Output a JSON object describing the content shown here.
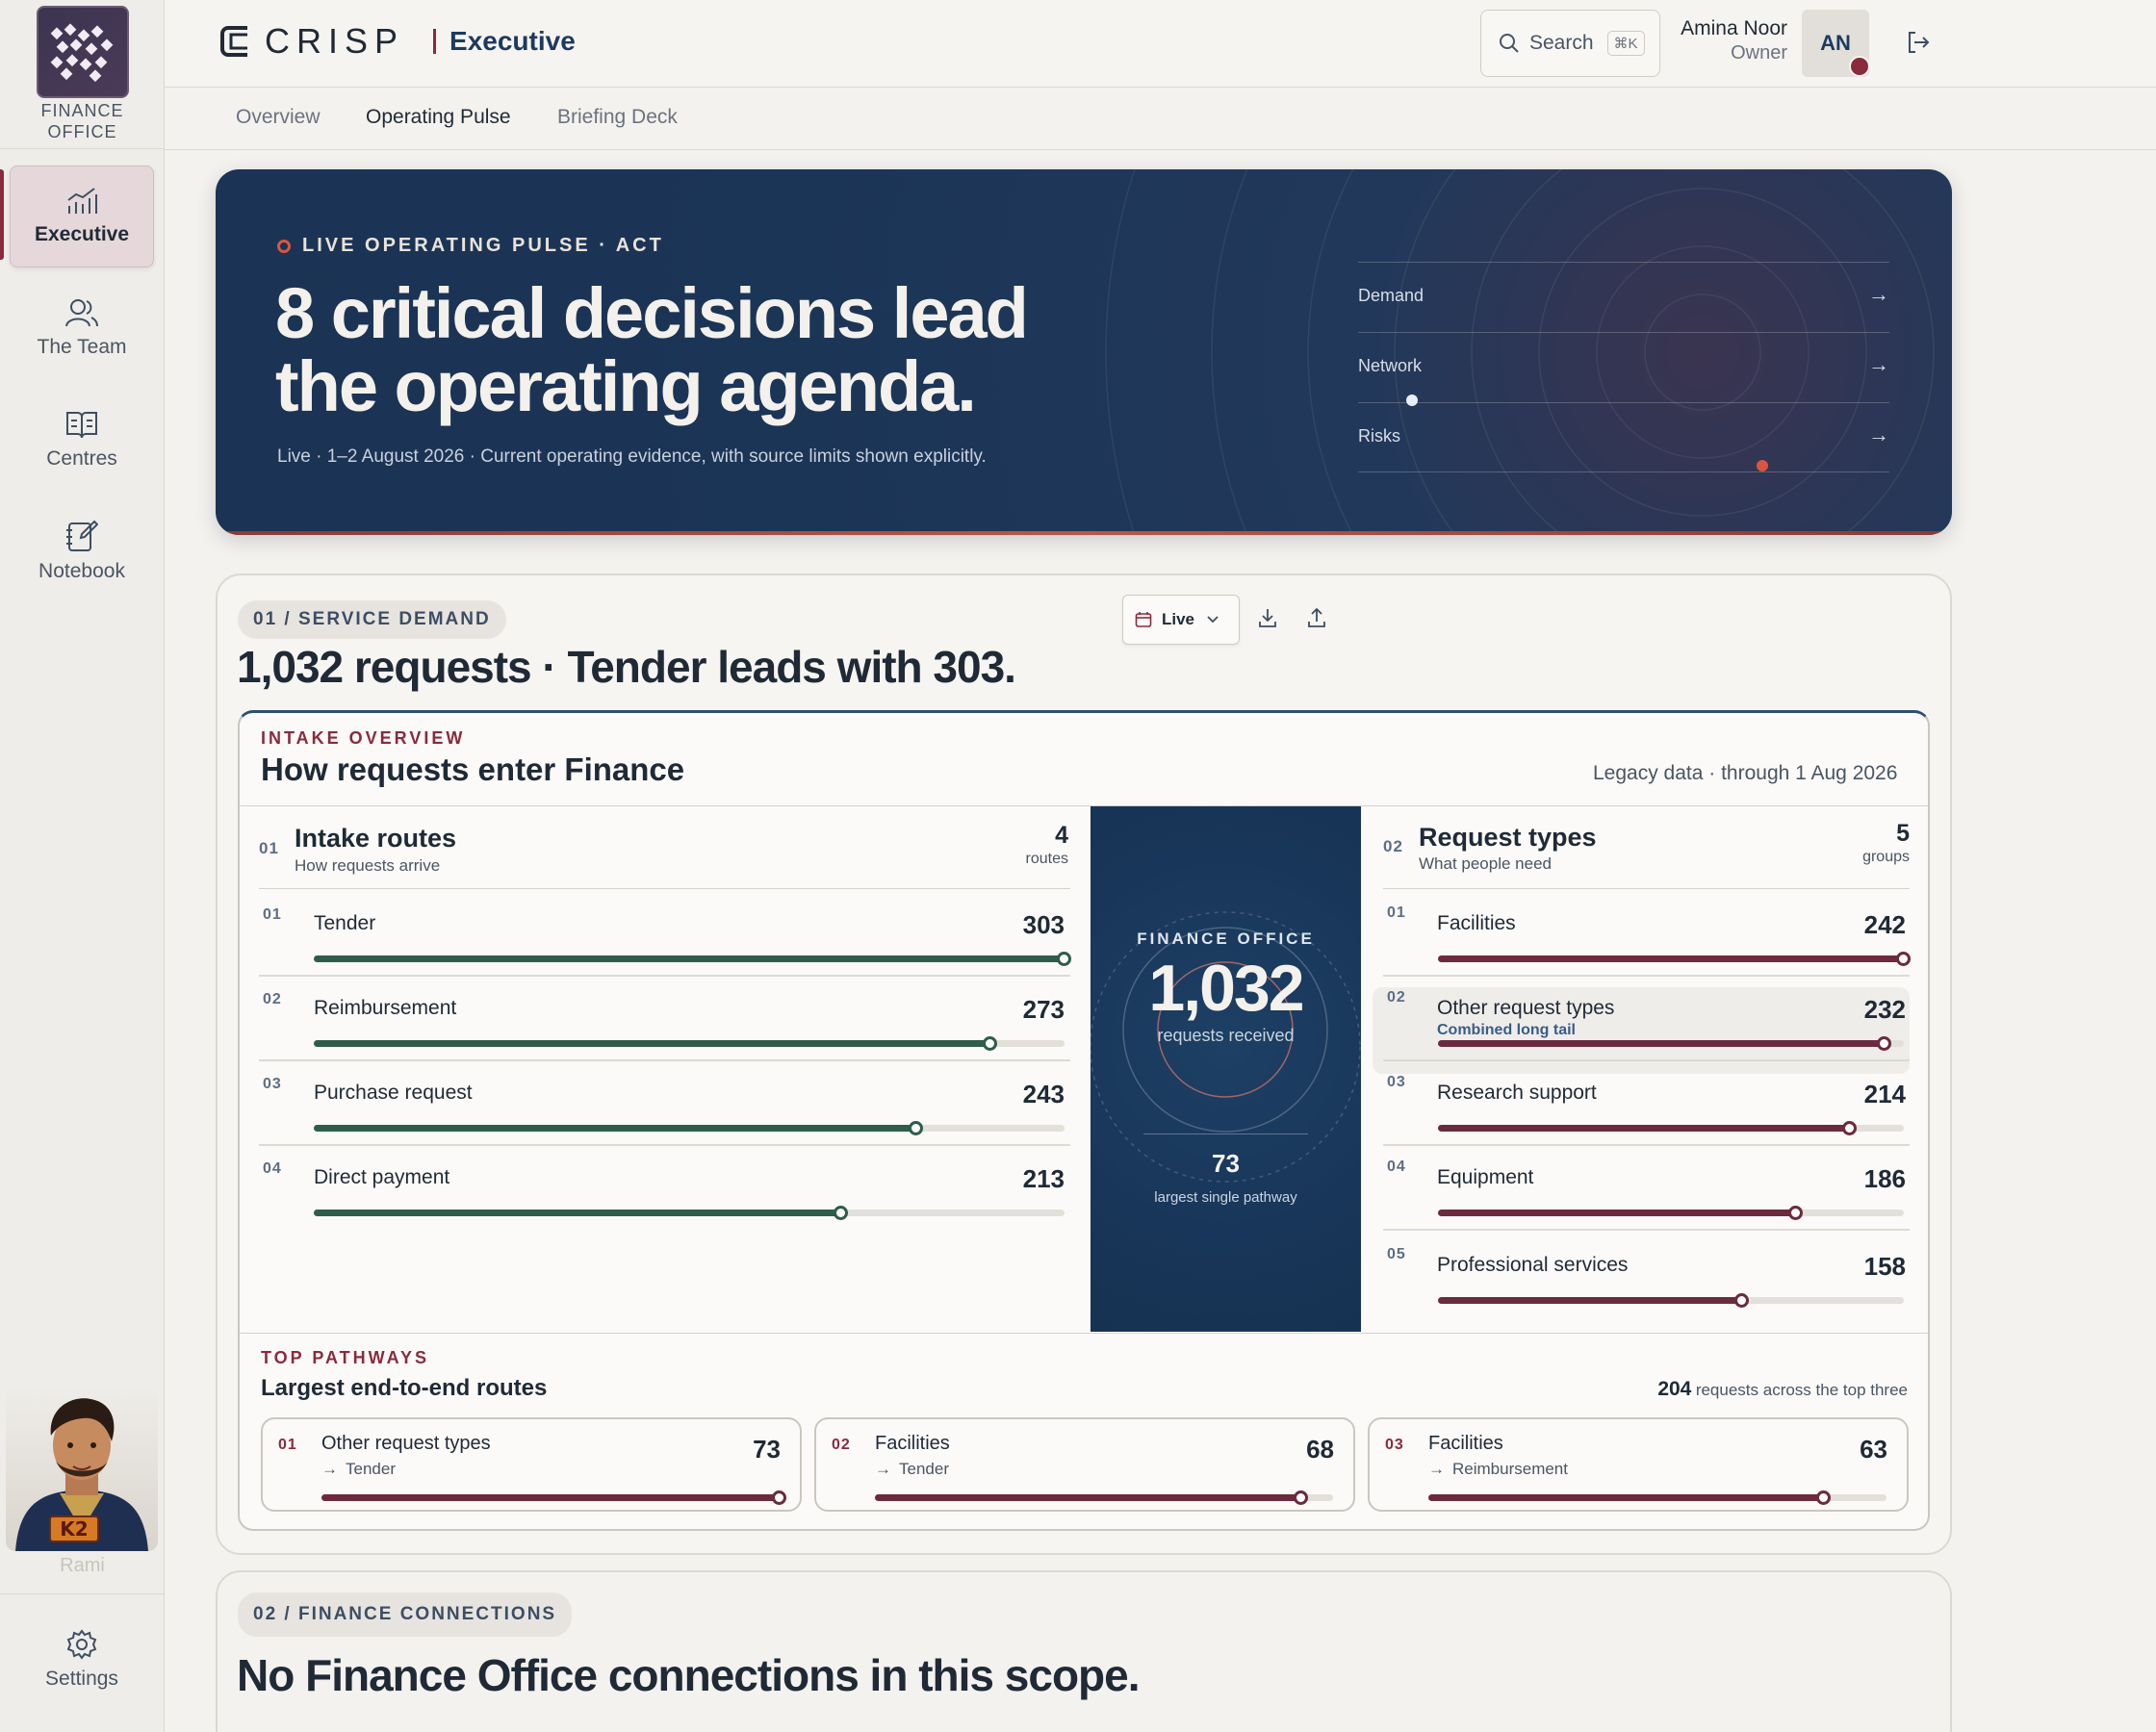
{
  "app": {
    "org_label": "FINANCE OFFICE",
    "brand": "CRISP",
    "section": "Executive"
  },
  "sidebar": {
    "items": [
      {
        "label": "Executive",
        "icon": "chart-icon",
        "active": true
      },
      {
        "label": "The Team",
        "icon": "users-icon",
        "active": false
      },
      {
        "label": "Centres",
        "icon": "book-icon",
        "active": false
      },
      {
        "label": "Notebook",
        "icon": "notebook-icon",
        "active": false
      }
    ],
    "avatar_badge": "K2",
    "avatar_name": "Rami",
    "settings_label": "Settings"
  },
  "header": {
    "search_label": "Search",
    "search_shortcut": "⌘K",
    "user_name": "Amina Noor",
    "user_role": "Owner",
    "user_initials": "AN"
  },
  "tabs": [
    {
      "label": "Overview",
      "active": false
    },
    {
      "label": "Operating Pulse",
      "active": true
    },
    {
      "label": "Briefing Deck",
      "active": false
    }
  ],
  "hero": {
    "kicker": "LIVE OPERATING PULSE · ACT",
    "title": "8 critical decisions lead the operating agenda.",
    "subtitle": "Live · 1–2 August 2026 · Current operating evidence, with source limits shown explicitly.",
    "links": [
      {
        "label": "Demand",
        "arrow": "→"
      },
      {
        "label": "Network",
        "arrow": "→"
      },
      {
        "label": "Risks",
        "arrow": "→"
      }
    ]
  },
  "service_demand": {
    "pill": "01 / SERVICE DEMAND",
    "headline": "1,032 requests · Tender leads with 303.",
    "period_label": "Live",
    "intake": {
      "kicker": "INTAKE OVERVIEW",
      "title": "How requests enter Finance",
      "meta": "Legacy data · through 1 Aug 2026",
      "routes": {
        "num": "01",
        "title": "Intake routes",
        "subtitle": "How requests arrive",
        "count": "4",
        "unit": "routes",
        "max": 303,
        "color": "#2e5d4c",
        "rows": [
          {
            "num": "01",
            "label": "Tender",
            "value": 303
          },
          {
            "num": "02",
            "label": "Reimbursement",
            "value": 273
          },
          {
            "num": "03",
            "label": "Purchase request",
            "value": 243
          },
          {
            "num": "04",
            "label": "Direct payment",
            "value": 213
          }
        ]
      },
      "centre": {
        "kicker": "FINANCE OFFICE",
        "total": "1,032",
        "total_label": "requests received",
        "largest": "73",
        "largest_label": "largest single pathway"
      },
      "types": {
        "num": "02",
        "title": "Request types",
        "subtitle": "What people need",
        "count": "5",
        "unit": "groups",
        "max": 242,
        "color": "#6b2a3f",
        "rows": [
          {
            "num": "01",
            "label": "Facilities",
            "sub": "",
            "value": 242
          },
          {
            "num": "02",
            "label": "Other request types",
            "sub": "Combined long tail",
            "value": 232
          },
          {
            "num": "03",
            "label": "Research support",
            "sub": "",
            "value": 214
          },
          {
            "num": "04",
            "label": "Equipment",
            "sub": "",
            "value": 186
          },
          {
            "num": "05",
            "label": "Professional services",
            "sub": "",
            "value": 158
          }
        ]
      },
      "pathways": {
        "kicker": "TOP PATHWAYS",
        "title": "Largest end-to-end routes",
        "total": "204",
        "total_label": "requests across the top three",
        "max": 73,
        "items": [
          {
            "num": "01",
            "label": "Other request types",
            "dest": "Tender",
            "value": 73
          },
          {
            "num": "02",
            "label": "Facilities",
            "dest": "Tender",
            "value": 68
          },
          {
            "num": "03",
            "label": "Facilities",
            "dest": "Reimbursement",
            "value": 63
          }
        ]
      }
    }
  },
  "finance_connections": {
    "pill": "02 / FINANCE CONNECTIONS",
    "headline": "No Finance Office connections in this scope."
  }
}
